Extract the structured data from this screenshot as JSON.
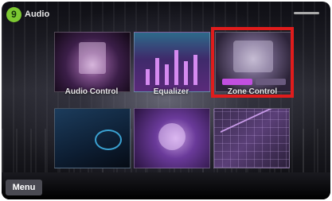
{
  "header": {
    "app_icon_glyph": "9",
    "app_title": "Audio"
  },
  "tiles": [
    {
      "label": "Audio Control"
    },
    {
      "label": "Equalizer"
    },
    {
      "label": "Zone Control"
    },
    {
      "label": ""
    },
    {
      "label": ""
    },
    {
      "label": ""
    }
  ],
  "footer": {
    "menu_label": "Menu",
    "page_indicator": ""
  },
  "colors": {
    "highlight": "#e01c1c",
    "app_icon": "#7cc832"
  }
}
